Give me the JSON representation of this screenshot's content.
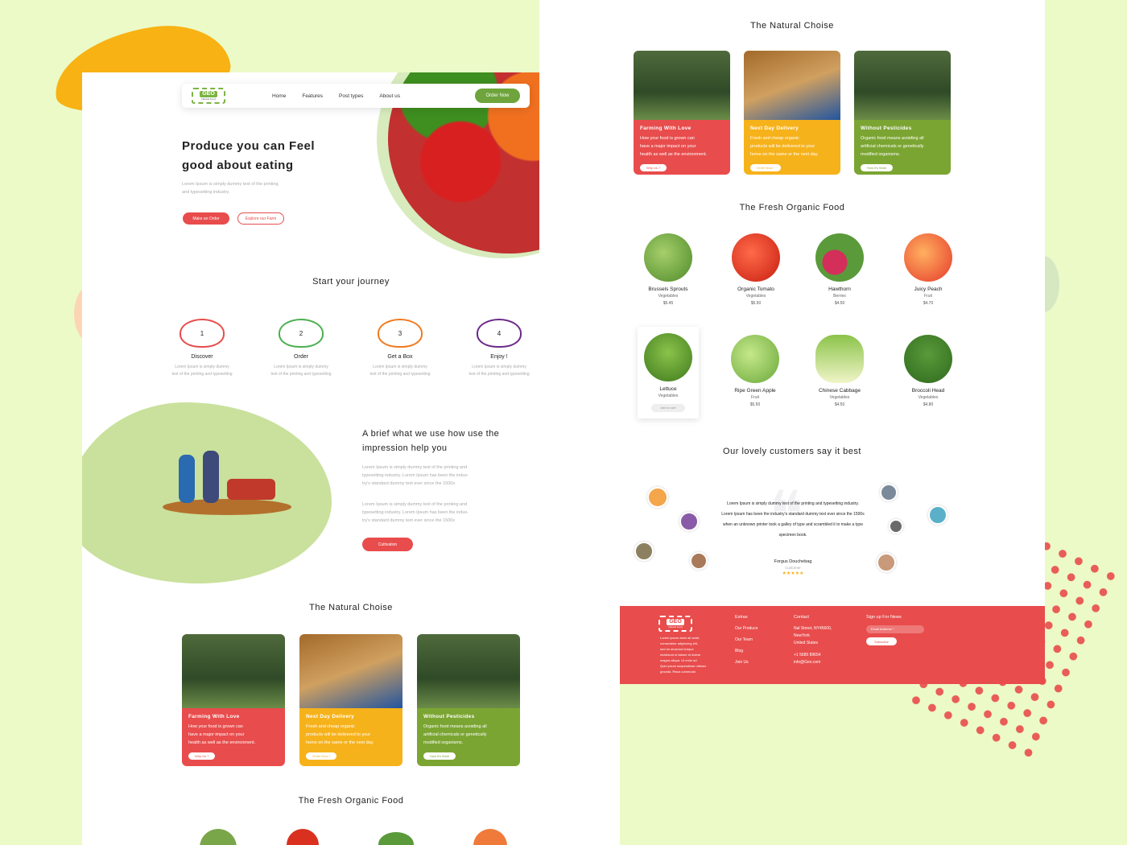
{
  "brand": {
    "logo": "GEO",
    "tagline": "Natural Food"
  },
  "nav": {
    "links": [
      "Home",
      "Features",
      "Post types",
      "About us"
    ],
    "cta": "Order Now"
  },
  "hero": {
    "title_line1": "Produce you can Feel",
    "title_line2": "good about eating",
    "subtitle_line1": "Lorem Ipsum is simply dummy text of the printing",
    "subtitle_line2": "and typesetting industry.",
    "btn_primary": "Make an Order",
    "btn_secondary": "Explore our Farm"
  },
  "journey": {
    "title": "Start your journey",
    "steps": [
      {
        "num": "1",
        "title": "Discover",
        "d1": "Lorem Ipsum is simply dummy",
        "d2": "text of the printing and typesetting"
      },
      {
        "num": "2",
        "title": "Order",
        "d1": "Lorem Ipsum is simply dummy",
        "d2": "text of the printing and typesetting"
      },
      {
        "num": "3",
        "title": "Get a Box",
        "d1": "Lorem Ipsum is simply dummy",
        "d2": "text of the printing and typesetting"
      },
      {
        "num": "4",
        "title": "Enjoy !",
        "d1": "Lorem Ipsum is simply dummy",
        "d2": "text of the printing and typesetting"
      }
    ]
  },
  "brief": {
    "title_line1": "A brief what we use how use the",
    "title_line2": "impression help you",
    "p1": [
      "Lorem Ipsum is simply dummy text of the printing and",
      "typesetting industry. Lorem Ipsum has been the indus-",
      "try's standard dummy text ever since the 1500s"
    ],
    "p2": [
      "Lorem Ipsum is simply dummy text of the printing and",
      "typesetting industry. Lorem Ipsum has been the indus-",
      "try's standard dummy text ever since the 1500s"
    ],
    "btn": "Cultivation"
  },
  "natural": {
    "title": "The Natural Choise",
    "cards": [
      {
        "title": "Farming With Love",
        "lines": [
          "How your food is grown can",
          "have a major impact on your",
          "health as well as the environment."
        ],
        "btn": "Why Us ?"
      },
      {
        "title": "Next Day Delivery",
        "lines": [
          "Fresh and cheap organic",
          "products will be delivered to your",
          "home on the same or the next day."
        ],
        "btn": "Order Now !"
      },
      {
        "title": "Without Pesticides",
        "lines": [
          "Organic food means avoiding all",
          "artificial chemicals or genetically",
          "modified organisms."
        ],
        "btn": "How it's Work"
      }
    ]
  },
  "fresh": {
    "title": "The Fresh Organic Food",
    "products": [
      {
        "name": "Brussels Sprouts",
        "cat": "Vegetables",
        "price": "$5.45"
      },
      {
        "name": "Organic Tomato",
        "cat": "Vegetables",
        "price": "$5.50"
      },
      {
        "name": "Hawthorn",
        "cat": "Berries",
        "price": "$4.50"
      },
      {
        "name": "Juicy Peach",
        "cat": "Fruit",
        "price": "$4.70"
      },
      {
        "name": "Lettuce",
        "cat": "Vegetables",
        "price": "",
        "btn": "Add to cart"
      },
      {
        "name": "Ripe Green Apple",
        "cat": "Fruit",
        "price": "$5.50"
      },
      {
        "name": "Chinese Cabbage",
        "cat": "Vegetables",
        "price": "$4.50"
      },
      {
        "name": "Broccoli Head",
        "cat": "Vegetables",
        "price": "$4.80"
      }
    ]
  },
  "testimonials": {
    "title": "Our lovely customers say it best",
    "lines": [
      "Lorem Ipsum is simply dummy text of the printing and typesetting industry.",
      "Lorem Ipsum has been the industry's standard dummy text ever since the 1500s",
      "when an unknown printer took a galley of type and scrambled it to make a type",
      "specimen book."
    ],
    "name": "Forgus Douchebag",
    "role": "Customer",
    "stars": "★★★★★"
  },
  "footer": {
    "about": [
      "Lorem ipsum dolor sit amet,",
      "consectetur adipiscing elit,",
      "sed do eiusmod tempor",
      "incididunt ut labore et dolore",
      "magna aliqua. Ut enim ad",
      "Quis ipsum suspendisse ultrices",
      "gravida. Risus commodo"
    ],
    "extras": {
      "title": "Extras",
      "items": [
        "Our Produce",
        "Our Team",
        "Blog",
        "Join Us"
      ]
    },
    "contact": {
      "title": "Contact",
      "lines": [
        "Nal Street, NY45600,",
        "NewYork",
        "United States",
        "+1 5689 89654",
        "info@Geo.com"
      ]
    },
    "news": {
      "title": "Sign up For News",
      "placeholder": "Email Address *",
      "btn": "Subscribe"
    }
  },
  "colors": {
    "red": "#e84c4c",
    "yellow": "#f6b21b",
    "green": "#7ba532",
    "bg": "#ecfac7"
  }
}
